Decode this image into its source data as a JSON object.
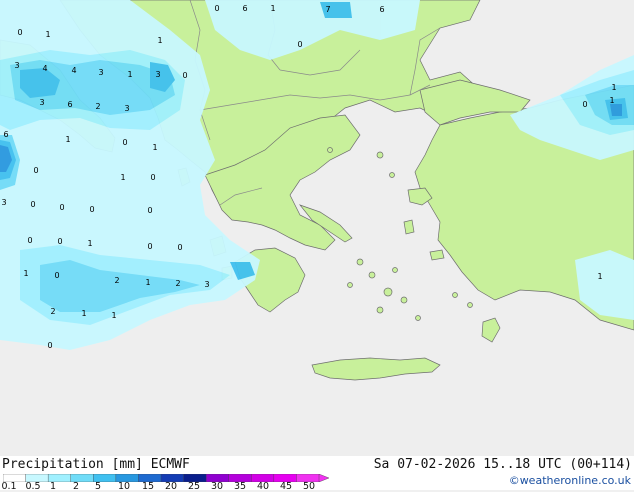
{
  "map": {
    "colors": {
      "sea": "#eeeeee",
      "land": "#c8f09b",
      "border": "#8a8a8a",
      "coast": "#6e6e6e"
    },
    "precip_labels": [
      "0",
      "6",
      "1",
      "7",
      "6",
      "0",
      "1",
      "1",
      "0",
      "3",
      "4",
      "4",
      "3",
      "1",
      "3",
      "0",
      "3",
      "6",
      "2",
      "3",
      "0",
      "1",
      "0",
      "1",
      "6",
      "0",
      "0",
      "1",
      "3",
      "0",
      "0",
      "0",
      "0",
      "0",
      "1",
      "0",
      "0",
      "1",
      "0",
      "2",
      "1",
      "2",
      "3",
      "1",
      "2",
      "1",
      "1",
      "0",
      "0",
      "1",
      "1"
    ]
  },
  "footer": {
    "title_left": "Precipitation [mm]  ECMWF",
    "title_right": "Sa 07-02-2026 15..18 UTC (00+114)",
    "credit": "©weatheronline.co.uk",
    "legend_ticks": [
      "0.1",
      "0.5",
      "1",
      "2",
      "5",
      "10",
      "15",
      "20",
      "25",
      "30",
      "35",
      "40",
      "45",
      "50"
    ],
    "legend_colors": [
      "#ffffff",
      "#c8f8ff",
      "#a0f0ff",
      "#70dcf8",
      "#40c0f0",
      "#2898e0",
      "#1e6ad0",
      "#143cb4",
      "#0a1e8c",
      "#9000d0",
      "#b400dc",
      "#d200e6",
      "#e600f0",
      "#f032f0"
    ]
  }
}
